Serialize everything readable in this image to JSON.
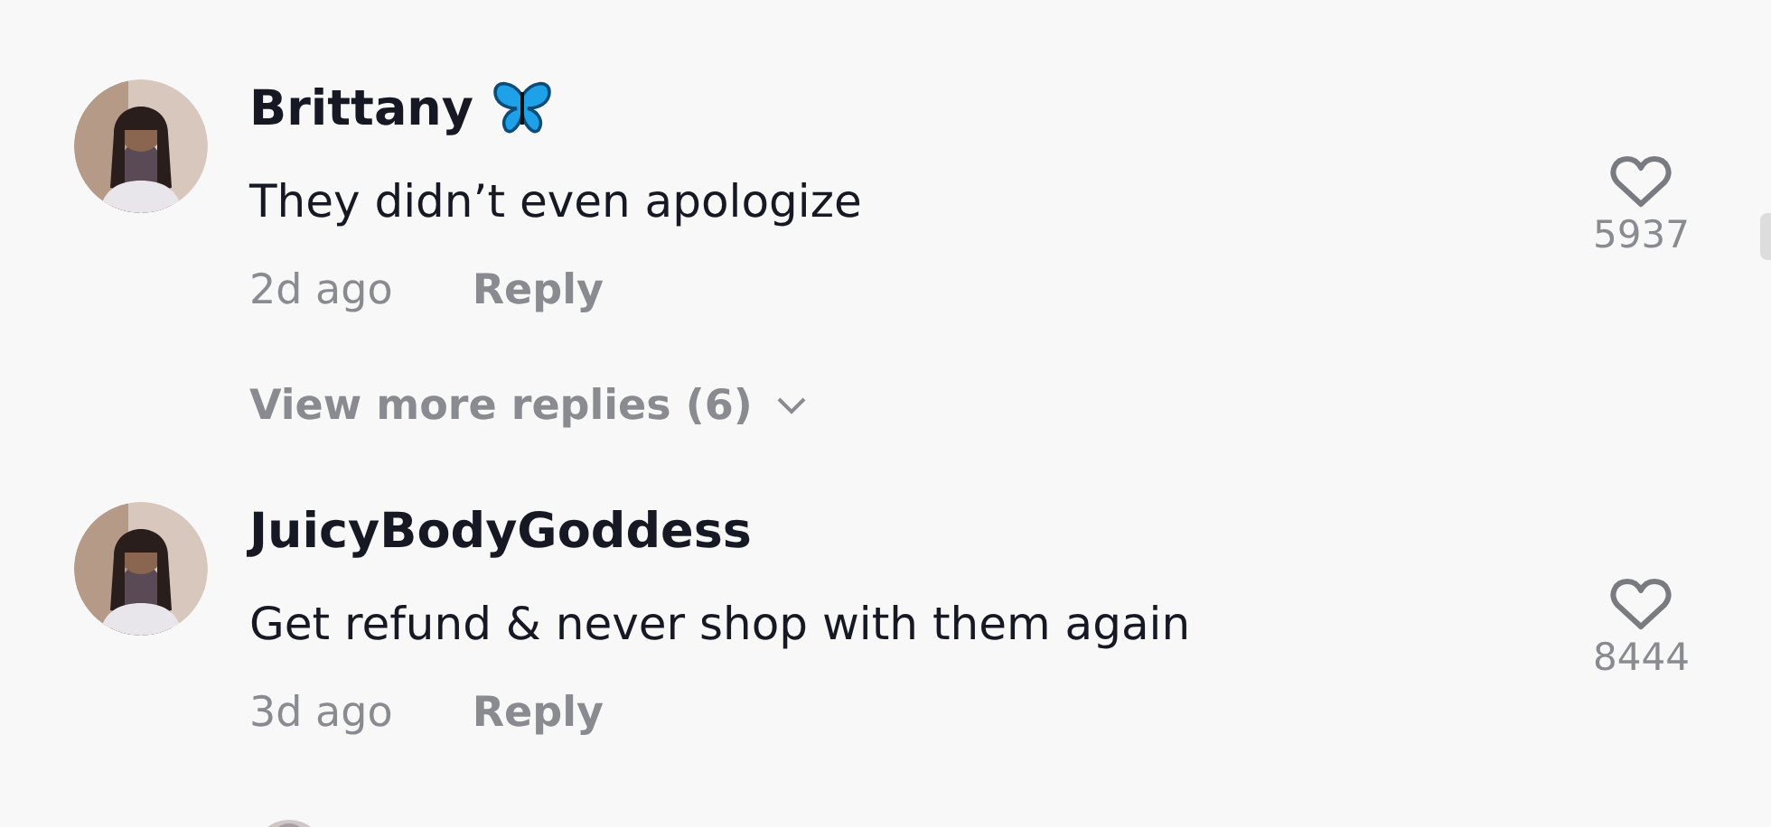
{
  "comments": [
    {
      "author": "Brittany",
      "has_badge": true,
      "text": "They didn’t even apologize",
      "time": "2d ago",
      "reply": "Reply",
      "likes": "5937",
      "replies_link": "View more replies (6)"
    },
    {
      "author": "JuicyBodyGoddess",
      "has_badge": false,
      "text": "Get refund & never shop with them again",
      "time": "3d ago",
      "reply": "Reply",
      "likes": "8444"
    }
  ]
}
